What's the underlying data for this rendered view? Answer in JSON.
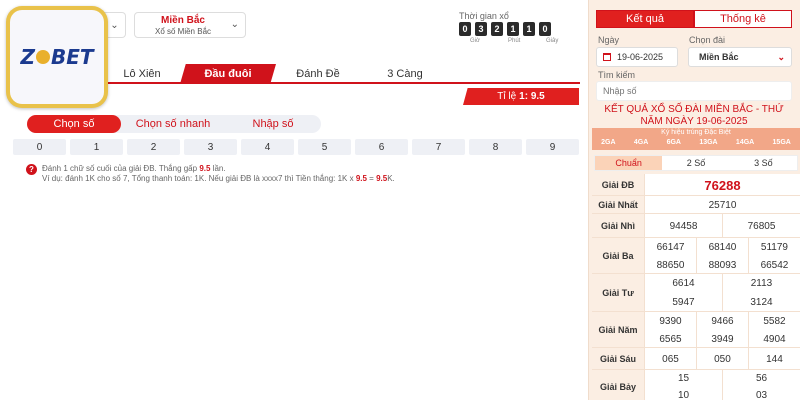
{
  "logo": {
    "text_left": "Z",
    "text_right": "BET"
  },
  "top": {
    "region_title": "Miền Bắc",
    "region_sub": "Xổ số Miền Bắc",
    "chevron": "⌄",
    "countdown_label": "Thời gian xổ",
    "countdown_digits": [
      "0",
      "3",
      "2",
      "1",
      "1",
      "0"
    ],
    "countdown_units": [
      "Giờ",
      "Phút",
      "Giây"
    ]
  },
  "tabs": [
    "Lô Xiên",
    "Đầu đuôi",
    "Đánh Đề",
    "3 Càng"
  ],
  "ratio": {
    "label": "Tỉ lệ",
    "value": "1: 9.5"
  },
  "modes": [
    "Chọn số",
    "Chọn số nhanh",
    "Nhập số"
  ],
  "numbers": [
    "0",
    "1",
    "2",
    "3",
    "4",
    "5",
    "6",
    "7",
    "8",
    "9"
  ],
  "hint": {
    "icon": "?",
    "line1_a": "Đánh 1 chữ số cuối của giải ĐB. Thắng gấp ",
    "line1_b": "9.5",
    "line1_c": " lần.",
    "line2_a": "Ví dụ: đánh 1K cho số 7, Tổng thanh toán: 1K. Nếu giải ĐB là xxxx7 thì Tiền thắng: 1K x ",
    "line2_b": "9.5",
    "line2_c": " = ",
    "line2_d": "9.5",
    "line2_e": "K."
  },
  "panel": {
    "tabs": [
      "Kết quả",
      "Thống kê"
    ],
    "date_label": "Ngày",
    "date_value": "19-06-2025",
    "region_label": "Chọn đài",
    "region_value": "Miền Bắc",
    "search_label": "Tìm kiếm",
    "search_placeholder": "Nhập số",
    "title_line1": "KẾT QUẢ XỔ SỐ ĐÀI MIỀN BẮC - THỨ",
    "title_line2": "NĂM NGÀY 19-06-2025",
    "code_label": "Ký hiệu trúng Đặc Biệt",
    "codes": [
      "2GA",
      "4GA",
      "6GA",
      "13GA",
      "14GA",
      "15GA"
    ],
    "sub_tabs": [
      "Chuẩn",
      "2 Số",
      "3 Số"
    ],
    "results": [
      {
        "label": "Giải ĐB",
        "values": [
          "76288"
        ]
      },
      {
        "label": "Giải Nhất",
        "values": [
          "25710"
        ]
      },
      {
        "label": "Giải Nhì",
        "values": [
          "94458",
          "76805"
        ]
      },
      {
        "label": "Giải Ba",
        "values": [
          "66147",
          "68140",
          "51179",
          "88650",
          "88093",
          "66542"
        ]
      },
      {
        "label": "Giải Tư",
        "values": [
          "6614",
          "2113",
          "5947",
          "3124"
        ]
      },
      {
        "label": "Giải Năm",
        "values": [
          "9390",
          "9466",
          "5582",
          "6565",
          "3949",
          "4904"
        ]
      },
      {
        "label": "Giải Sáu",
        "values": [
          "065",
          "050",
          "144"
        ]
      },
      {
        "label": "Giải Bảy",
        "values": [
          "15",
          "56",
          "10",
          "03"
        ]
      }
    ]
  }
}
